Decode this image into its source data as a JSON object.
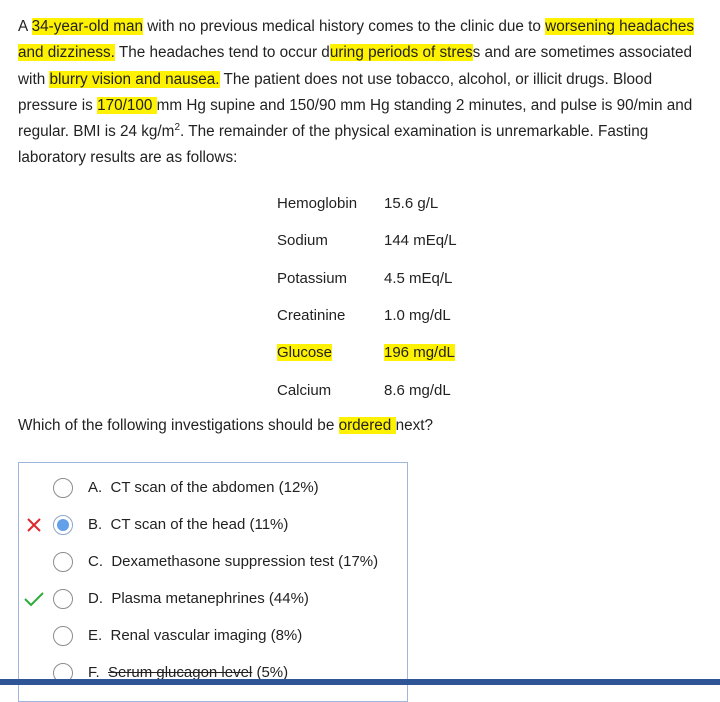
{
  "stem": {
    "seg_a": "A ",
    "hl_age": "34-year-old man",
    "seg_b": " with no previous medical history comes to the clinic due to ",
    "hl_symptoms": "worsening headaches and dizziness.",
    "seg_c": "  The headaches tend to occur d",
    "hl_stress": "uring periods of stres",
    "seg_d": "s and are sometimes associated with ",
    "hl_vision": "blurry vision and nausea.",
    "seg_e": "  The patient does not use tobacco, alcohol, or illicit drugs.  Blood pressure is ",
    "hl_bp": " 170/100 ",
    "seg_f": "mm Hg supine and 150/90 mm Hg standing 2 minutes, and pulse is 90/min and regular.  BMI is 24 kg/m",
    "seg_sup": "2",
    "seg_g": ".  The remainder of the physical examination is unremarkable.  Fasting laboratory results are as follows:"
  },
  "labs": [
    {
      "name": "Hemoglobin",
      "value": "15.6 g/L",
      "name_hl": false,
      "value_hl": false
    },
    {
      "name": "Sodium",
      "value": "144 mEq/L",
      "name_hl": false,
      "value_hl": false
    },
    {
      "name": "Potassium",
      "value": "4.5 mEq/L",
      "name_hl": false,
      "value_hl": false
    },
    {
      "name": "Creatinine",
      "value": "1.0 mg/dL",
      "name_hl": false,
      "value_hl": false
    },
    {
      "name": "Glucose",
      "value": "196 mg/dL",
      "name_hl": true,
      "value_hl": true
    },
    {
      "name": "Calcium",
      "value": "8.6 mg/dL",
      "name_hl": false,
      "value_hl": false
    }
  ],
  "question": {
    "seg_a": "Which of the following investigations should be ",
    "hl": "ordered ",
    "seg_b": "next?"
  },
  "choices": [
    {
      "label": "A.  CT scan of the abdomen (12%)",
      "selected": false,
      "mark": "",
      "struck": false
    },
    {
      "label": "B.  CT scan of the head (11%)",
      "selected": true,
      "mark": "incorrect",
      "struck": false
    },
    {
      "label": "C.  Dexamethasone suppression test (17%)",
      "selected": false,
      "mark": "",
      "struck": false
    },
    {
      "label": "D.  Plasma metanephrines (44%)",
      "selected": false,
      "mark": "correct",
      "struck": false
    },
    {
      "label": "E.  Renal vascular imaging (8%)",
      "selected": false,
      "mark": "",
      "struck": false
    },
    {
      "label": "F.  ",
      "struck_text": "Serum glucagon level",
      "suffix": " (5%)",
      "selected": false,
      "mark": "",
      "struck": true
    }
  ],
  "colors": {
    "highlight": "#fff200",
    "incorrect_mark": "#e0262b",
    "correct_mark": "#2eaa3a",
    "selected_radio": "#62a1e9",
    "bottom_bar": "#2f5597"
  }
}
